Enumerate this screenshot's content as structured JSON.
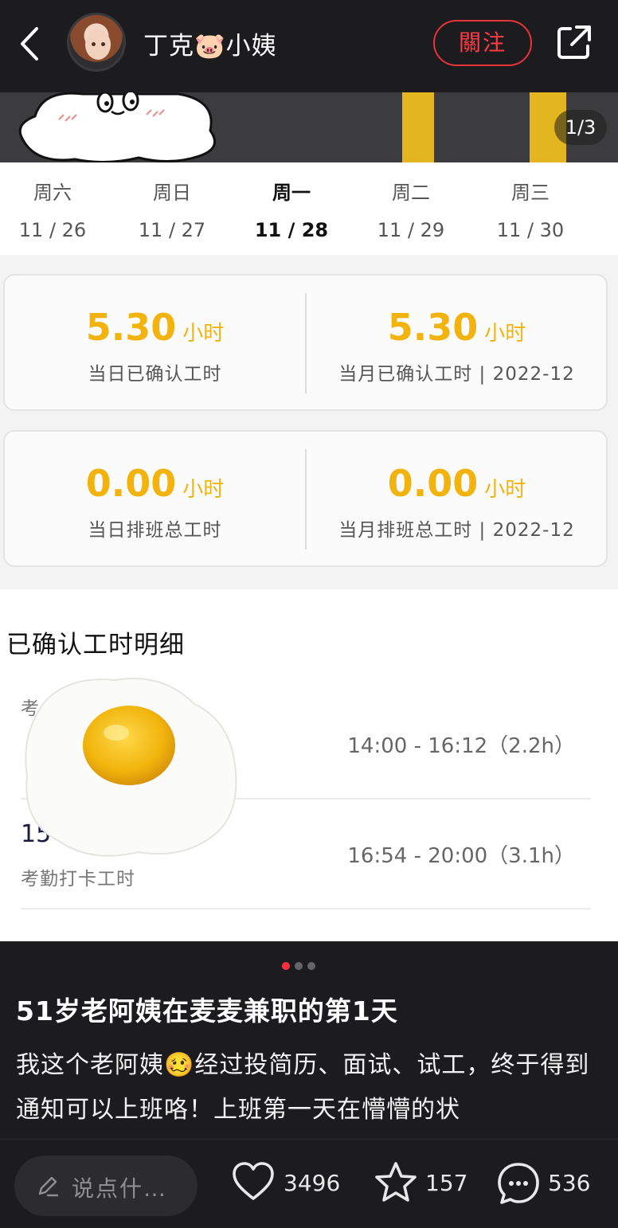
{
  "header": {
    "back_icon": "chevron-left-icon",
    "username": "丁克🐷小姨",
    "follow_label": "關注",
    "share_icon": "share-external-icon"
  },
  "photo": {
    "counter": "1/3",
    "days": [
      {
        "weekday": "周六",
        "date": "11 / 26",
        "active": false
      },
      {
        "weekday": "周日",
        "date": "11 / 27",
        "active": false
      },
      {
        "weekday": "周一",
        "date": "11 / 28",
        "active": true
      },
      {
        "weekday": "周二",
        "date": "11 / 29",
        "active": false
      },
      {
        "weekday": "周三",
        "date": "11 / 30",
        "active": false
      }
    ],
    "cards": [
      {
        "left": {
          "value": "5.30",
          "unit": "小时",
          "label": "当日已确认工时"
        },
        "right": {
          "value": "5.30",
          "unit": "小时",
          "label": "当月已确认工时 | 2022-12"
        }
      },
      {
        "left": {
          "value": "0.00",
          "unit": "小时",
          "label": "当日排班总工时"
        },
        "right": {
          "value": "0.00",
          "unit": "小时",
          "label": "当月排班总工时 | 2022-12"
        }
      }
    ],
    "detail": {
      "title": "已确认工时明细",
      "rows": [
        {
          "code": "",
          "sub": "考",
          "time": "14:00 - 16:12（2.2h）"
        },
        {
          "code": "15",
          "sub": "考勤打卡工时",
          "time": "16:54 - 20:00（3.1h）"
        }
      ]
    },
    "accent_color": "#f2b30f"
  },
  "carousel": {
    "count": 3,
    "current": 1
  },
  "post": {
    "title": "51岁老阿姨在麦麦兼职的第1天",
    "body": "我这个老阿姨🥴经过投简历、面试、试工，终于得到通知可以上班咯！上班第一天在懵懵的状"
  },
  "bottom": {
    "comment_placeholder": "说点什…",
    "likes": "3496",
    "stars": "157",
    "comments": "536"
  }
}
